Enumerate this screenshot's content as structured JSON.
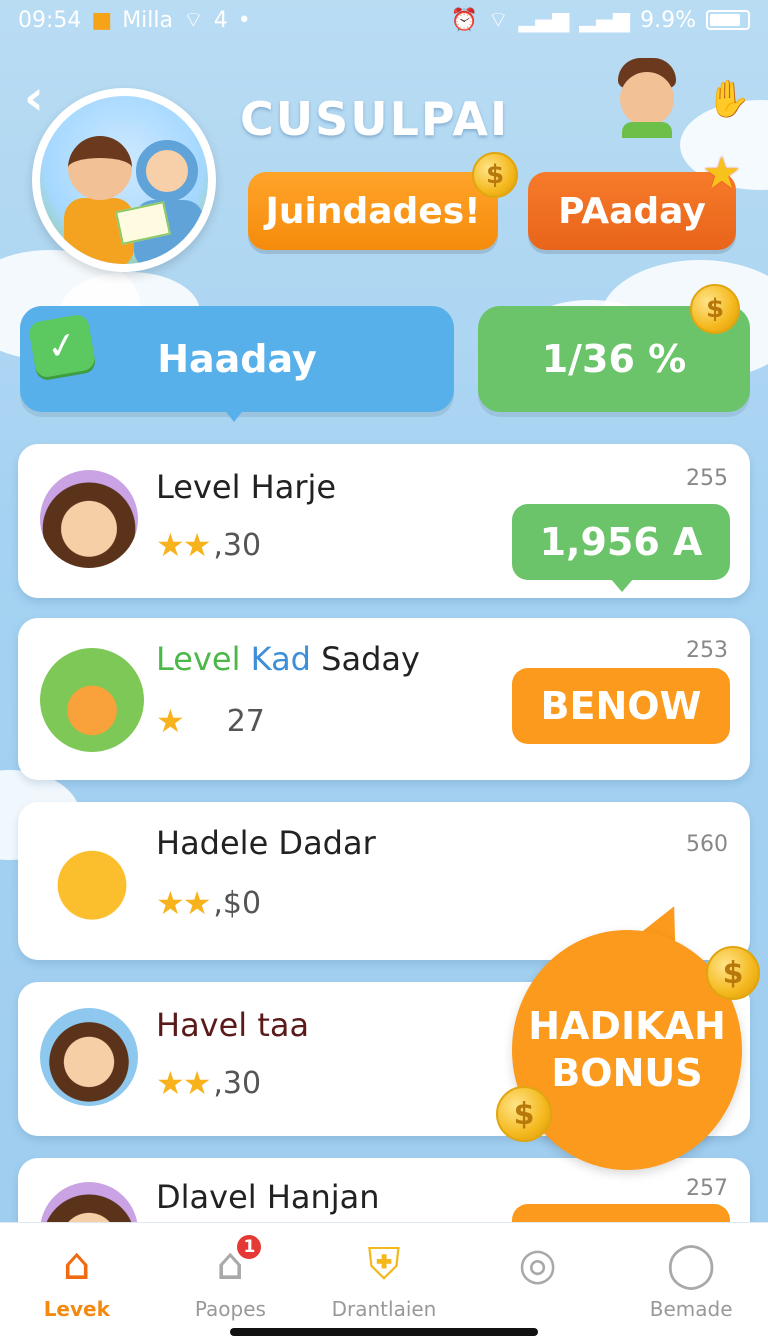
{
  "status_bar": {
    "time": "09:54",
    "carrier": "Milla",
    "signal_text": "4",
    "battery_percent": "9.9%"
  },
  "header": {
    "title": "CUSULPAI",
    "btn_left": "Juindades!",
    "btn_right": "PAaday"
  },
  "banners": {
    "left": "Haaday",
    "right": "1/36 %"
  },
  "cards": [
    {
      "title_parts": [
        "Level Harje"
      ],
      "stars": "★★",
      "score": ",30",
      "num": "255",
      "action": "1,956 A",
      "action_color": "#6cc46a"
    },
    {
      "title_parts": [
        "Level",
        "Kad",
        "Saday"
      ],
      "stars": "★",
      "score": "27",
      "num": "253",
      "action": "BENOW",
      "action_color": "#fb9a1c"
    },
    {
      "title_parts": [
        "Hadele Dadar"
      ],
      "stars": "★★",
      "score": ",$0",
      "num": "560",
      "action": "",
      "action_color": ""
    },
    {
      "title_parts": [
        "Havel taa"
      ],
      "stars": "★★",
      "score": ",30",
      "num": "",
      "action": "",
      "action_color": ""
    },
    {
      "title_parts": [
        "Dlavel Hanjan"
      ],
      "stars": "",
      "score": "",
      "num": "257",
      "action": "",
      "action_color": "#fb9a1c"
    }
  ],
  "bonus": {
    "line1": "HADIKAH",
    "line2": "BONUS"
  },
  "nav": {
    "items": [
      {
        "label": "Levek",
        "icon": "home-icon",
        "badge": ""
      },
      {
        "label": "Paopes",
        "icon": "house-badge-icon",
        "badge": "1"
      },
      {
        "label": "Drantlaien",
        "icon": "shield-key-icon",
        "badge": ""
      },
      {
        "label": "",
        "icon": "camera-icon",
        "badge": ""
      },
      {
        "label": "Bemade",
        "icon": "profile-icon",
        "badge": ""
      }
    ]
  },
  "colors": {
    "accent_orange": "#fb9a1c",
    "accent_green": "#6cc46a",
    "accent_blue": "#58b0ea"
  }
}
